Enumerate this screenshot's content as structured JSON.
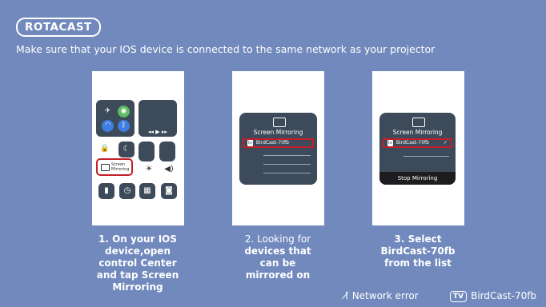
{
  "brand": "ROTACAST",
  "notice": "Make sure that your IOS device is connected to the same network as your projector",
  "steps": [
    {
      "l1": "1. On your IOS",
      "l2": "device,open",
      "l3": "control Center",
      "l4": "and tap Screen",
      "l5": "Mirroring"
    },
    {
      "l1": "2. Looking for",
      "l2": "devices that",
      "l3": "can be",
      "l4": "mirrored on"
    },
    {
      "l1": "3. Select",
      "l2": "BirdCast-70fb",
      "l3": "from the list"
    }
  ],
  "mock": {
    "screen_mirroring_btn_line1": "Screen",
    "screen_mirroring_btn_line2": "Mirroring",
    "panel_title": "Screen Mirroring",
    "tv_badge": "tv",
    "device_name": "BirdCast-70fb",
    "stop_label": "Stop Mirroring",
    "checkmark": "✓"
  },
  "status": {
    "network": "Network error",
    "tv_badge": "TV",
    "device": "BirdCast-70fb"
  },
  "colors": {
    "background": "#7189bc",
    "highlight": "#c41e2a",
    "panel": "#3d4a5a"
  }
}
